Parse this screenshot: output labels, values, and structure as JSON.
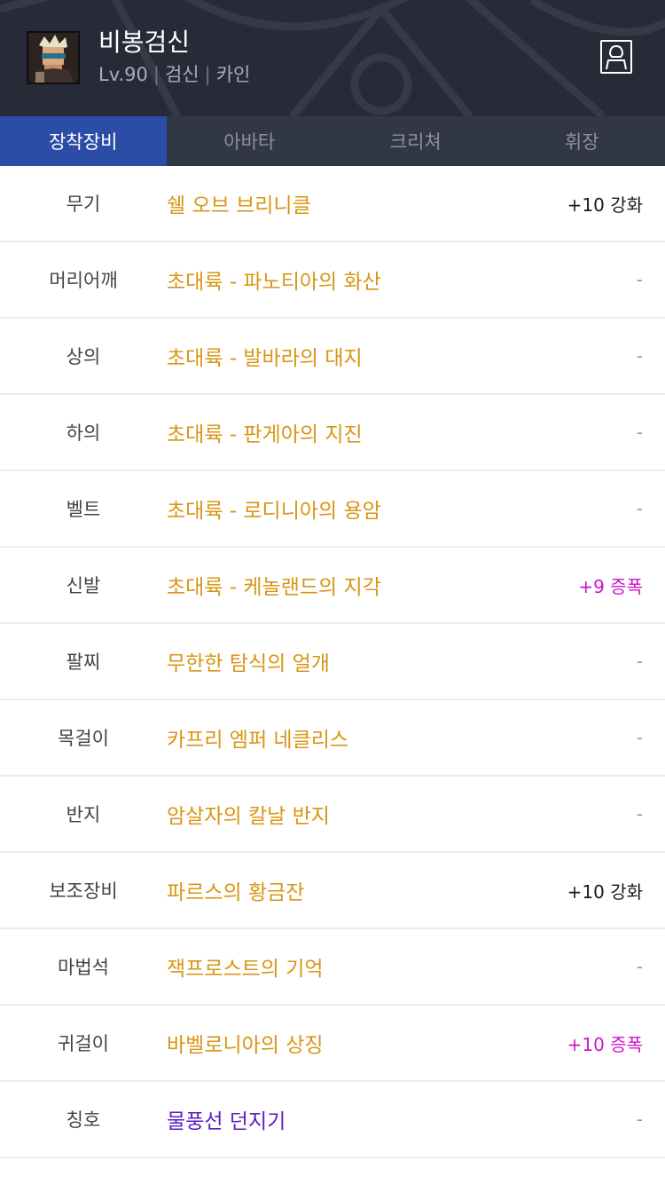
{
  "character": {
    "name": "비봉검신",
    "level": "Lv.90",
    "job": "검신",
    "server": "카인",
    "separator": "|"
  },
  "header": {
    "profile_icon": "person-icon"
  },
  "tabs": [
    {
      "label": "장착장비",
      "active": true
    },
    {
      "label": "아바타",
      "active": false
    },
    {
      "label": "크리쳐",
      "active": false
    },
    {
      "label": "휘장",
      "active": false
    }
  ],
  "equipment": [
    {
      "slot": "무기",
      "item": "쉘 오브 브리니클",
      "status": "+10 강화",
      "status_type": "reinforce"
    },
    {
      "slot": "머리어깨",
      "item": "초대륙 - 파노티아의 화산",
      "status": "-",
      "status_type": "none"
    },
    {
      "slot": "상의",
      "item": "초대륙 - 발바라의 대지",
      "status": "-",
      "status_type": "none"
    },
    {
      "slot": "하의",
      "item": "초대륙 - 판게아의 지진",
      "status": "-",
      "status_type": "none"
    },
    {
      "slot": "벨트",
      "item": "초대륙 - 로디니아의 용암",
      "status": "-",
      "status_type": "none"
    },
    {
      "slot": "신발",
      "item": "초대륙 - 케놀랜드의 지각",
      "status": "+9 증폭",
      "status_type": "amplify"
    },
    {
      "slot": "팔찌",
      "item": "무한한 탐식의 얼개",
      "status": "-",
      "status_type": "none"
    },
    {
      "slot": "목걸이",
      "item": "카프리 엠퍼 네클리스",
      "status": "-",
      "status_type": "none"
    },
    {
      "slot": "반지",
      "item": "암살자의 칼날 반지",
      "status": "-",
      "status_type": "none"
    },
    {
      "slot": "보조장비",
      "item": "파르스의 황금잔",
      "status": "+10 강화",
      "status_type": "reinforce"
    },
    {
      "slot": "마법석",
      "item": "잭프로스트의 기억",
      "status": "-",
      "status_type": "none"
    },
    {
      "slot": "귀걸이",
      "item": "바벨로니아의 상징",
      "status": "+10 증폭",
      "status_type": "amplify"
    },
    {
      "slot": "칭호",
      "item": "물풍선 던지기",
      "status": "-",
      "status_type": "none",
      "rarity": "rare"
    }
  ],
  "colors": {
    "header_bg": "#272b37",
    "tab_active": "#2c4da6",
    "epic_item": "#d89614",
    "rare_item": "#5a1ec0",
    "amplify": "#cc14cc"
  }
}
